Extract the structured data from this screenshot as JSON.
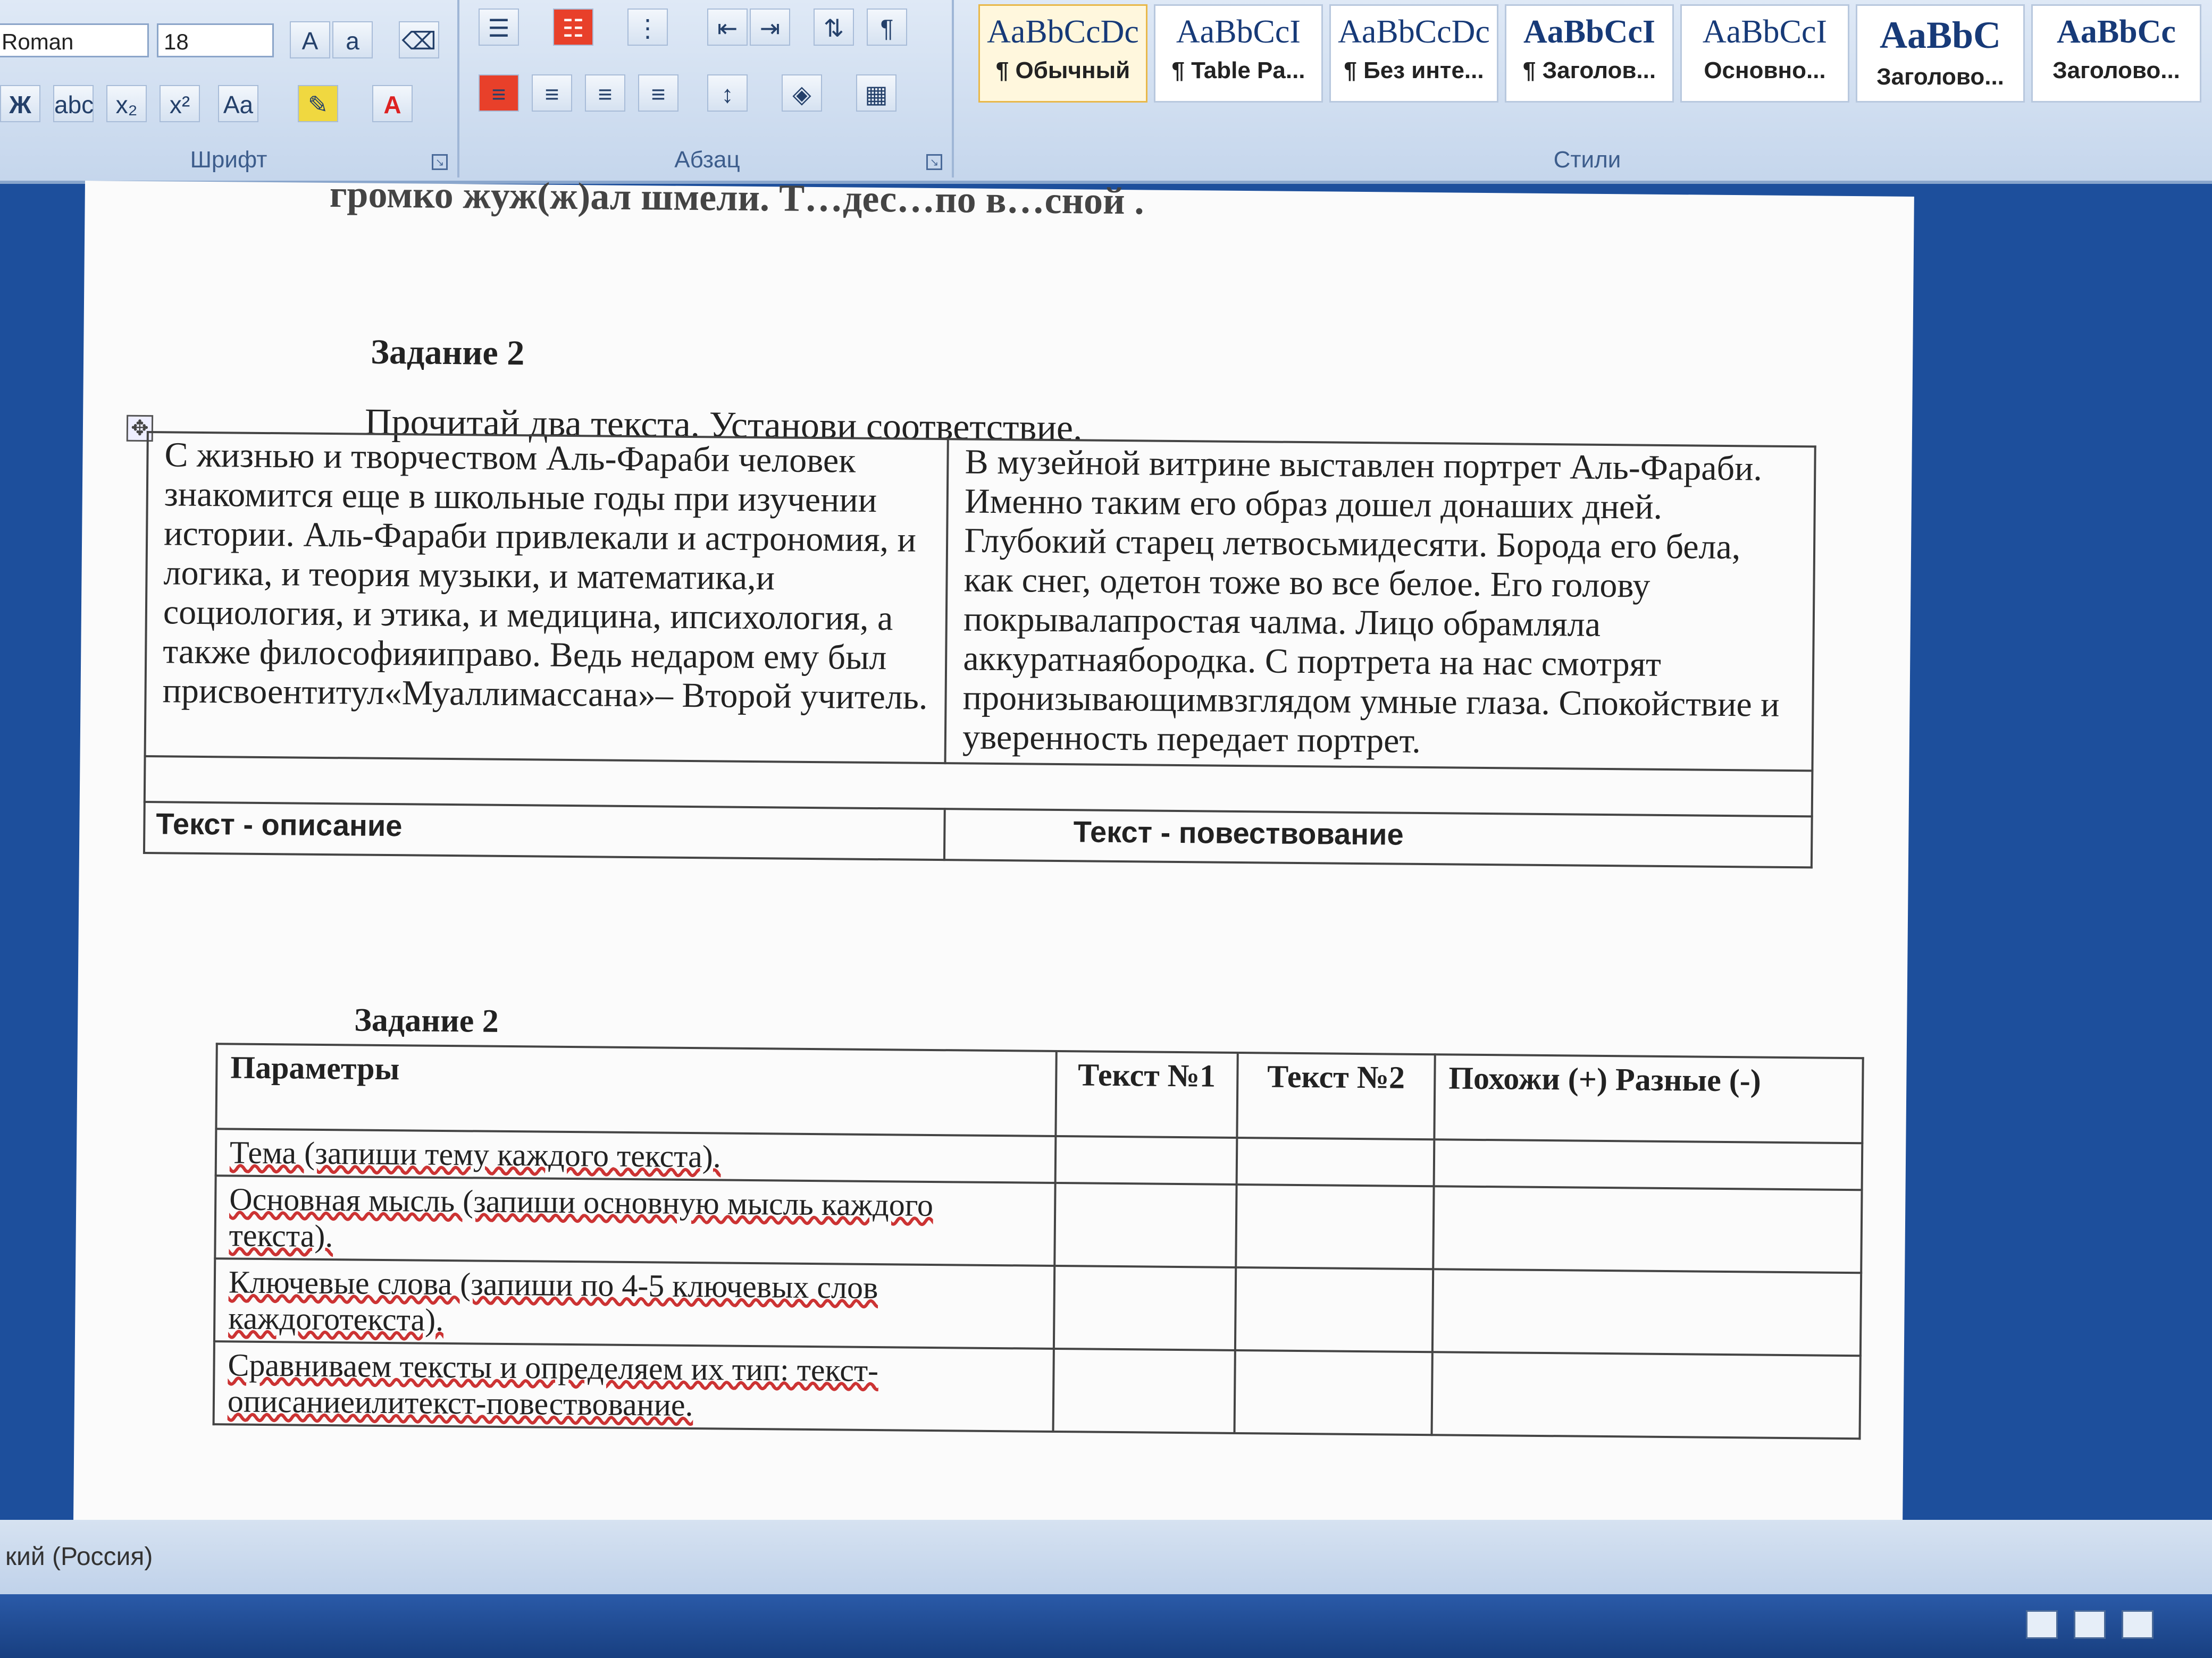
{
  "ribbon": {
    "font_name": "Roman",
    "font_size": "18",
    "groups": {
      "font_label": "Шрифт",
      "paragraph_label": "Абзац",
      "styles_label": "Стили"
    },
    "styles": [
      {
        "sample": "AaBbCcDc",
        "name": "¶ Обычный"
      },
      {
        "sample": "AaBbCcI",
        "name": "¶ Table Pa..."
      },
      {
        "sample": "AaBbCcDc",
        "name": "¶ Без инте..."
      },
      {
        "sample": "AaBbCcI",
        "name": "¶ Заголов..."
      },
      {
        "sample": "AaBbCcI",
        "name": "Основно..."
      },
      {
        "sample": "AaBbC",
        "name": "Заголово..."
      },
      {
        "sample": "AaBbCc",
        "name": "Заголово..."
      }
    ]
  },
  "document": {
    "cut_line": "громко жуж(ж)ал шмели.  Т…дес…по в…сной .",
    "task1": {
      "title": "Задание 2",
      "instruction": "Прочитай два текста. Установи соответствие.",
      "text1": "С жизнью и творчеством Аль-Фараби человек знакомится еще в школьные годы при изучении истории. Аль-Фараби привлекали и астрономия, и логика, и теория музыки, и математика,и социология, и этика, и медицина, ипсихология,     а также философияиправо. Ведь недаром ему был присвоентитул«Муаллимассана»– Второй учитель.",
      "text2": "В музейной витрине выставлен портрет Аль-Фараби. Именно таким его образ дошел донаших    дней. Глубокий старец летвосьмидесяти. Борода его бела, как снег, одетон тоже во все белое. Его голову покрывалапростая чалма. Лицо обрамляла аккуратнаябородка. С портрета на нас смотрят пронизывающимвзглядом  умные глаза. Спокойствие и уверенность передает портрет.",
      "label1": "Текст - описание",
      "label2": "Текст - повествование"
    },
    "task2": {
      "title": "Задание 2",
      "headers": [
        "Параметры",
        "Текст №1",
        "Текст №2",
        "Похожи (+) Разные (-)"
      ],
      "rows": [
        "Тема (запиши тему каждого текста).",
        "Основная мысль (запиши основную мысль каждого текста).",
        "Ключевые слова (запиши по 4-5 ключевых слов каждоготекста).",
        "Сравниваем тексты и определяем их тип: текст-описаниеилитекст-повествование."
      ]
    }
  },
  "statusbar": {
    "language": "кий (Россия)"
  }
}
